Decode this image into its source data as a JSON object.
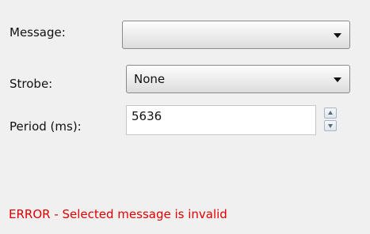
{
  "form": {
    "message_label": "Message:",
    "message_value": "",
    "strobe_label": "Strobe:",
    "strobe_value": "None",
    "period_label": "Period (ms):",
    "period_value": "5636"
  },
  "error": {
    "text": "ERROR - Selected message is invalid",
    "color": "#e00000"
  },
  "icons": {
    "dropdown_arrow": "chevron-down-icon",
    "spin_up": "spin-up-icon",
    "spin_down": "spin-down-icon"
  }
}
